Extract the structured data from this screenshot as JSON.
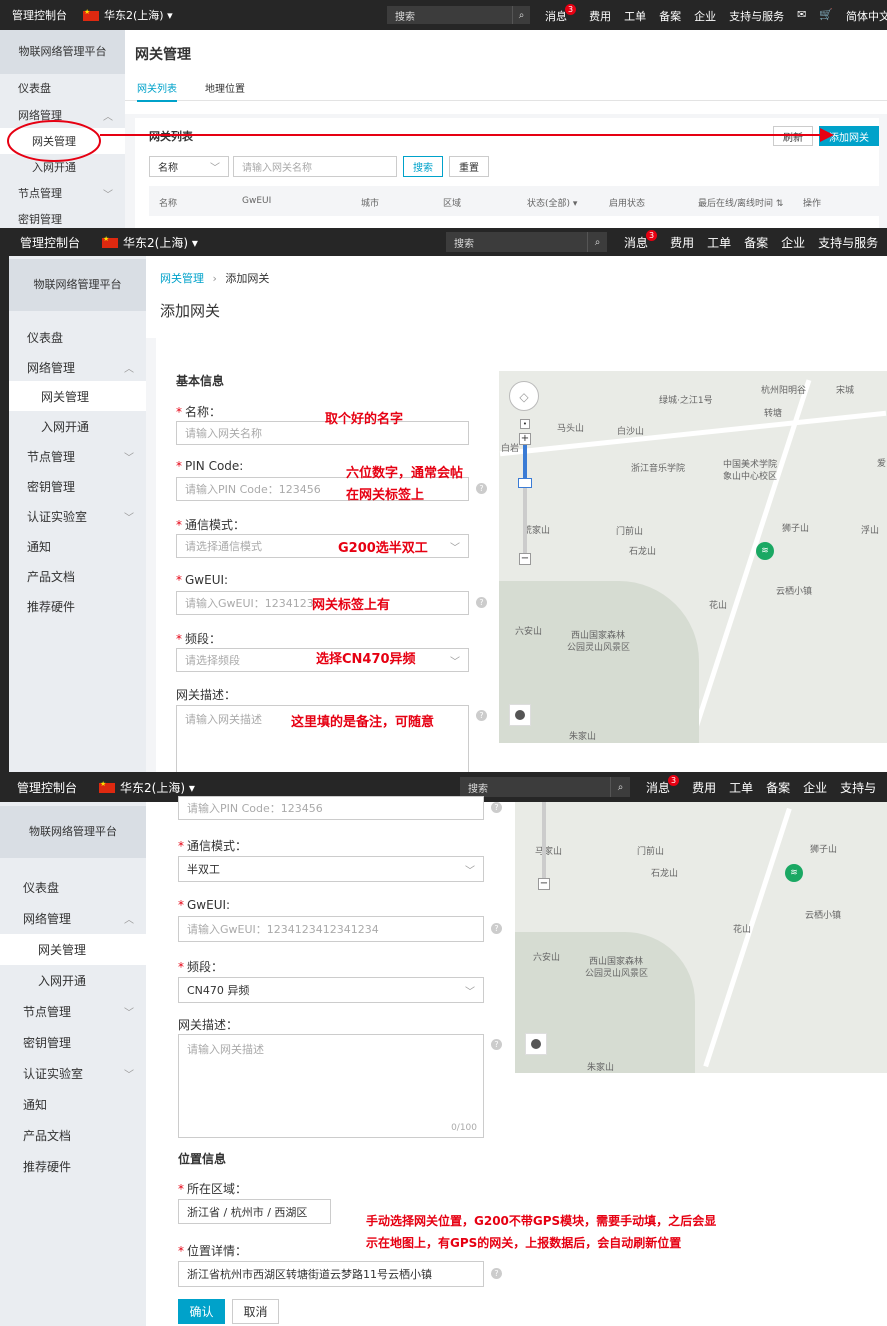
{
  "topbar": {
    "console": "管理控制台",
    "region": "华东2(上海)",
    "search_placeholder": "搜索",
    "messages": "消息",
    "message_count": "3",
    "nav_p1": [
      "费用",
      "工单",
      "备案",
      "企业",
      "支持与服务",
      "简体中文"
    ],
    "nav_p2": [
      "费用",
      "工单",
      "备案",
      "企业",
      "支持与服务"
    ],
    "nav_p3": [
      "费用",
      "工单",
      "备案",
      "企业",
      "支持与"
    ]
  },
  "sidebar": {
    "platform": "物联网络管理平台",
    "items": [
      "仪表盘",
      "网络管理",
      "网关管理",
      "入网开通",
      "节点管理",
      "密钥管理",
      "认证实验室",
      "通知",
      "产品文档",
      "推荐硬件"
    ]
  },
  "panel1": {
    "page_title": "网关管理",
    "tabs": [
      "网关列表",
      "地理位置"
    ],
    "section_title": "网关列表",
    "refresh": "刷新",
    "add_gateway": "添加网关",
    "filter_select": "名称",
    "filter_placeholder": "请输入网关名称",
    "search_btn": "搜索",
    "reset_btn": "重置",
    "columns": [
      "名称",
      "GwEUI",
      "城市",
      "区域",
      "状态(全部) ▾",
      "启用状态",
      "最后在线/离线时间 ⇅",
      "操作"
    ]
  },
  "panel2": {
    "breadcrumb_link": "网关管理",
    "breadcrumb_current": "添加网关",
    "page_title": "添加网关",
    "section_basic": "基本信息",
    "name_label": "名称：",
    "name_placeholder": "请输入网关名称",
    "pin_label": "PIN Code:",
    "pin_placeholder": "请输入PIN Code：123456",
    "mode_label": "通信模式：",
    "mode_placeholder": "请选择通信模式",
    "gweui_label": "GwEUI:",
    "gweui_placeholder": "请输入GwEUI：1234123412341234",
    "band_label": "频段：",
    "band_placeholder": "请选择频段",
    "desc_label": "网关描述：",
    "desc_placeholder": "请输入网关描述",
    "annotations": [
      "取个好的名字",
      "六位数字，通常会帖",
      "在网关标签上",
      "G200选半双工",
      "网关标签上有",
      "选择CN470异频",
      "这里填的是备注，可随意"
    ]
  },
  "panel3": {
    "pin_placeholder": "请输入PIN Code：123456",
    "mode_label": "通信模式：",
    "mode_value": "半双工",
    "gweui_label": "GwEUI:",
    "gweui_placeholder": "请输入GwEUI：1234123412341234",
    "band_label": "频段：",
    "band_value": "CN470 异频",
    "desc_label": "网关描述：",
    "desc_placeholder": "请输入网关描述",
    "desc_counter": "0/100",
    "section_location": "位置信息",
    "area_label": "所在区域：",
    "area_value": "浙江省 / 杭州市 / 西湖区",
    "address_label": "位置详情：",
    "address_value": "浙江省杭州市西湖区转塘街道云梦路11号云栖小镇",
    "confirm": "确认",
    "cancel": "取消",
    "annotation_line1": "手动选择网关位置，G200不带GPS模块，需要手动填，之后会显",
    "annotation_line2": "示在地图上，有GPS的网关，上报数据后，会自动刷新位置"
  },
  "map": {
    "labels2": [
      "杭州阳明谷",
      "宋城",
      "绿城·之江1号",
      "转塘",
      "马头山",
      "白沙山",
      "白岩",
      "浙江音乐学院",
      "中国美术学院",
      "象山中心校区",
      "门前山",
      "石龙山",
      "狮子山",
      "浮山",
      "荒家山",
      "云栖小镇",
      "花山",
      "六安山",
      "西山国家森林",
      "公园灵山风景区",
      "朱家山",
      "爱"
    ],
    "labels3": [
      "马家山",
      "门前山",
      "石龙山",
      "狮子山",
      "云栖小镇",
      "花山",
      "六安山",
      "西山国家森林",
      "公园灵山风景区",
      "朱家山"
    ]
  },
  "colors": {
    "accent": "#00a2ca",
    "annotation": "#e60012",
    "topbar": "#262626"
  }
}
